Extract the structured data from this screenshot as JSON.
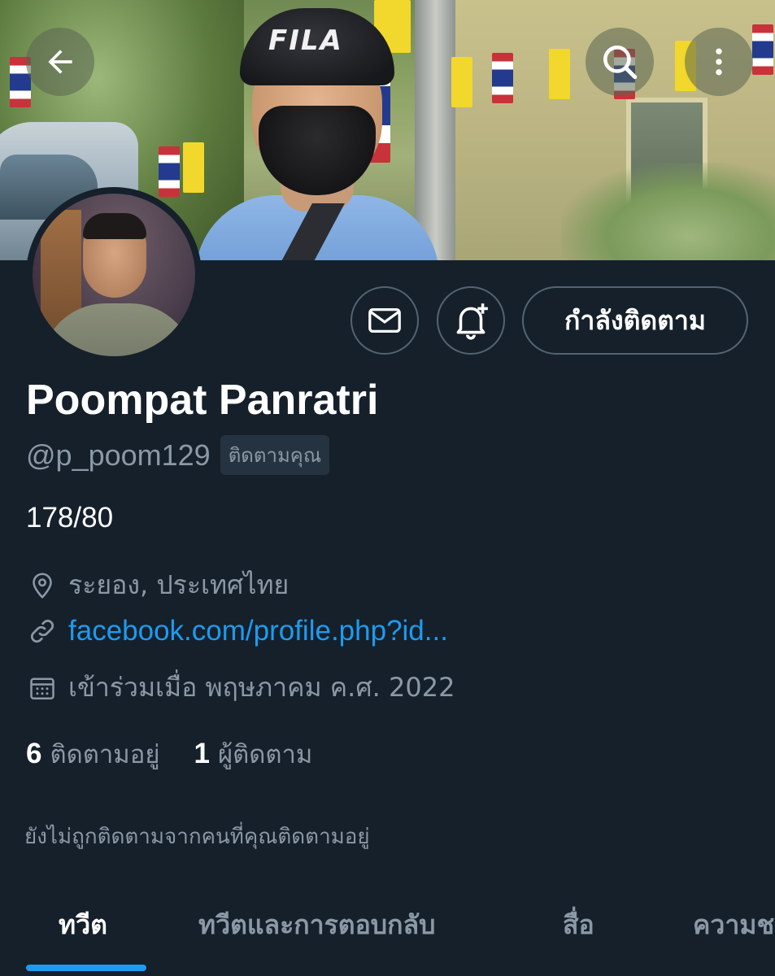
{
  "header": {
    "back_icon": "arrow-left-icon",
    "search_icon": "search-icon",
    "more_icon": "more-vertical-icon",
    "cap_logo": "FILA"
  },
  "actions": {
    "message_icon": "mail-icon",
    "notify_icon": "bell-plus-icon",
    "follow_label": "กำลังติดตาม"
  },
  "profile": {
    "name": "Poompat Panratri",
    "handle": "@p_poom129",
    "follows_you_badge": "ติดตามคุณ",
    "bio": "178/80",
    "location": "ระยอง, ประเทศไทย",
    "website": "facebook.com/profile.php?id...",
    "joined": "เข้าร่วมเมื่อ พฤษภาคม ค.ศ. 2022"
  },
  "stats": {
    "following_count": "6",
    "following_label": "ติดตามอยู่",
    "followers_count": "1",
    "followers_label": "ผู้ติดตาม"
  },
  "notice": "ยังไม่ถูกติดตามจากคนที่คุณติดตามอยู่",
  "tabs": [
    {
      "label": "ทวีต",
      "active": true
    },
    {
      "label": "ทวีตและการตอบกลับ",
      "active": false
    },
    {
      "label": "สื่อ",
      "active": false
    },
    {
      "label": "ความชอบ",
      "active": false
    }
  ],
  "colors": {
    "background": "#15202b",
    "accent": "#1d9bf0",
    "secondary_text": "#8b98a5",
    "border": "#536471"
  }
}
